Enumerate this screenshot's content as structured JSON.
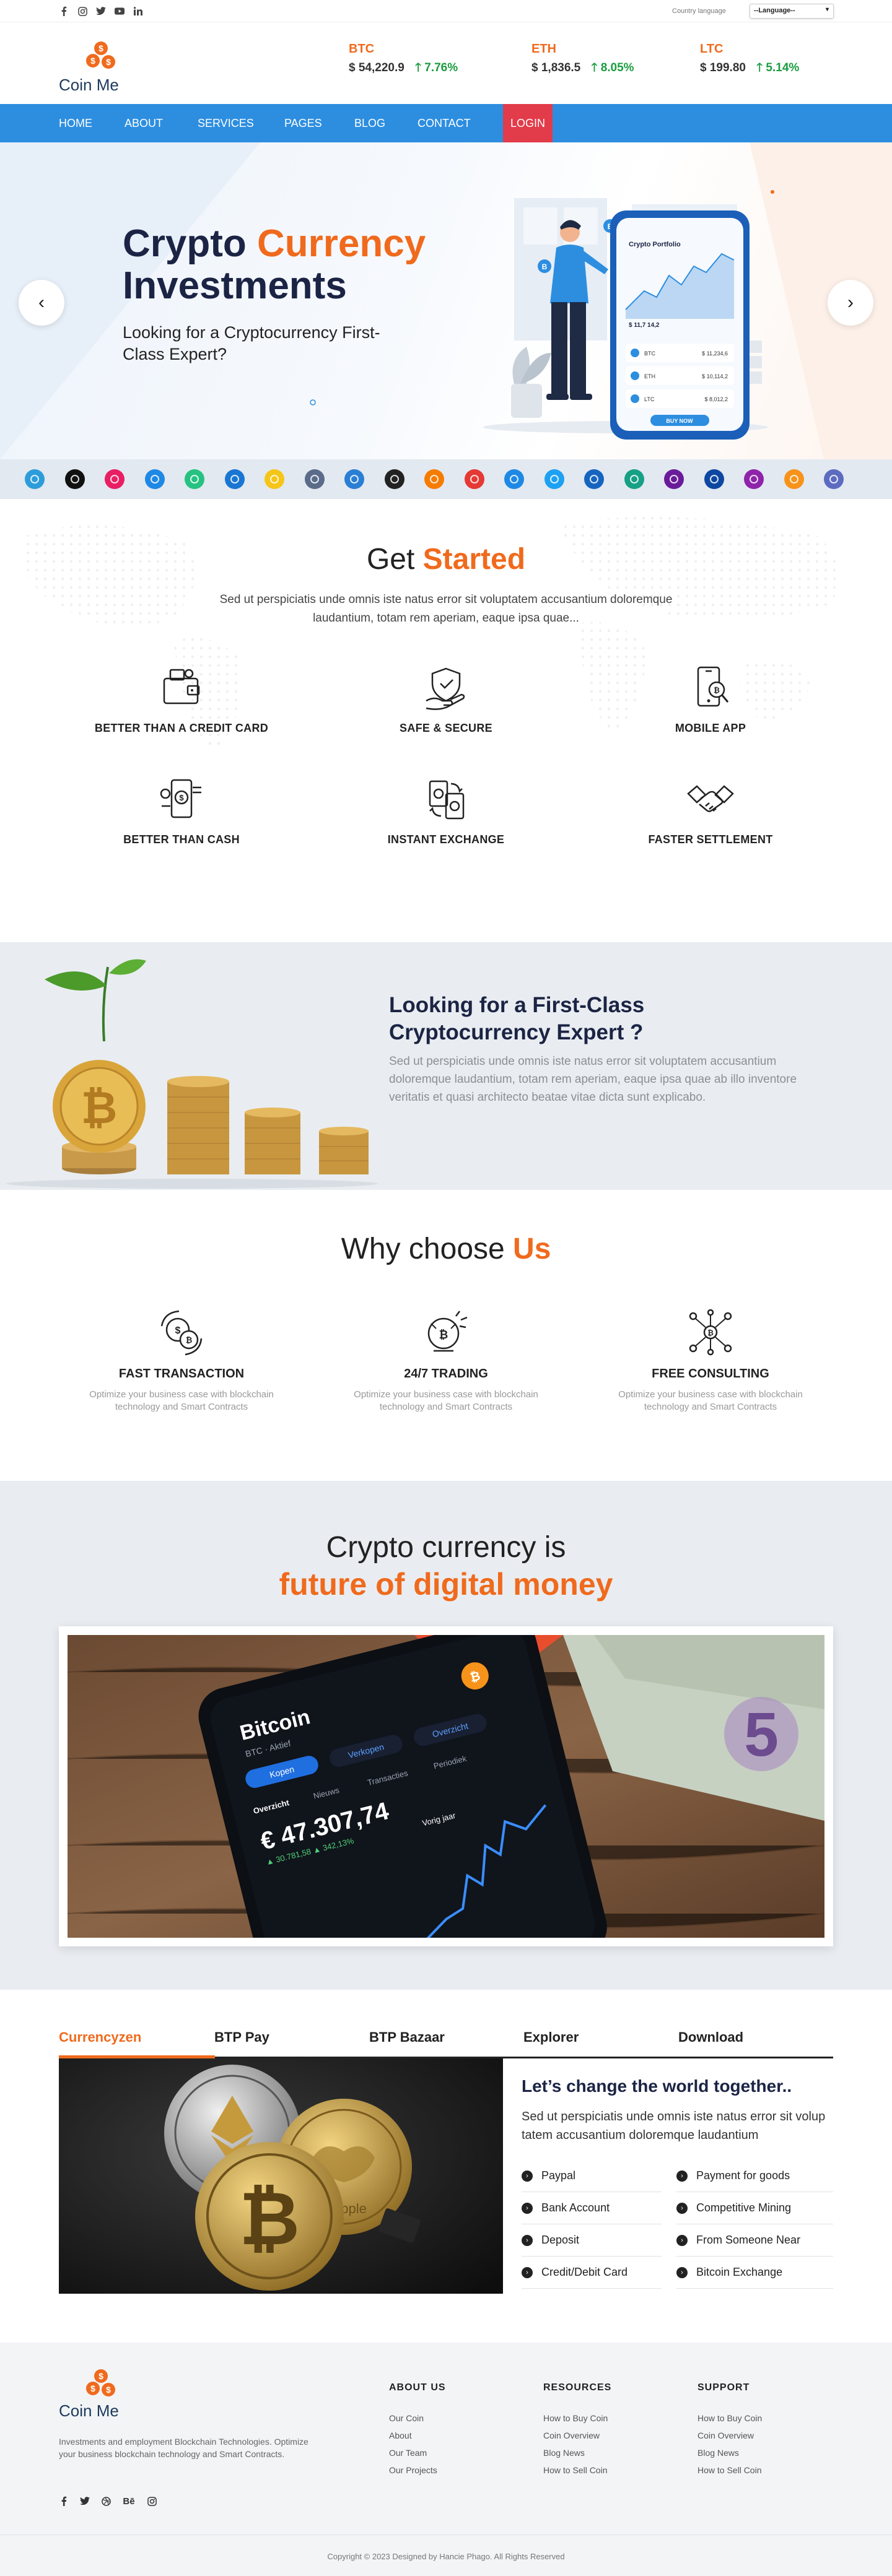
{
  "topbar": {
    "social": [
      "facebook-icon",
      "instagram-icon",
      "twitter-icon",
      "youtube-icon",
      "linkedin-icon"
    ],
    "language_label": "Country language",
    "language_value": "--Language--"
  },
  "header": {
    "logo_text": "Coin Me",
    "tickers": [
      {
        "name": "BTC",
        "price": "$ 54,220.9",
        "change": "7.76%"
      },
      {
        "name": "ETH",
        "price": "$ 1,836.5",
        "change": "8.05%"
      },
      {
        "name": "LTC",
        "price": "$ 199.80",
        "change": "5.14%"
      }
    ]
  },
  "nav": {
    "items": [
      "HOME",
      "ABOUT",
      "SERVICES",
      "PAGES",
      "BLOG",
      "CONTACT"
    ],
    "login": "LOGIN"
  },
  "hero": {
    "title_part1": "Crypto ",
    "title_part2": "Currency",
    "title_line2": "Investments",
    "subtitle": "Looking for a Cryptocurrency First-Class Expert?",
    "phone_title": "Crypto Portfolio",
    "phone_balance": "$ 11,7 14,2",
    "phone_rows": [
      {
        "coin": "BTC",
        "value": "$ 11,234,6"
      },
      {
        "coin": "ETH",
        "value": "$ 10,114,2"
      },
      {
        "coin": "LTC",
        "value": "$ 8,012,2"
      }
    ],
    "phone_button": "BUY NOW"
  },
  "coin_strip": {
    "colors": [
      "#2d9cdb",
      "#111111",
      "#e91e63",
      "#1e88e5",
      "#26c281",
      "#1976d2",
      "#f5c518",
      "#5b6b8a",
      "#2a7fd4",
      "#222222",
      "#f57c00",
      "#e53935",
      "#1e88e5",
      "#1da1f2",
      "#1565c0",
      "#16a085",
      "#6a1b9a",
      "#0d47a1",
      "#8e24aa",
      "#f7931a",
      "#5c6bc0"
    ]
  },
  "get_started": {
    "title_plain": "Get ",
    "title_accent": "Started",
    "description": "Sed ut perspiciatis unde omnis iste natus error sit voluptatem accusantium doloremque laudantium, totam rem aperiam, eaque ipsa quae...",
    "features": [
      {
        "label": "BETTER THAN A CREDIT CARD",
        "icon": "wallet-card-icon"
      },
      {
        "label": "SAFE & SECURE",
        "icon": "secure-hand-icon"
      },
      {
        "label": "MOBILE APP",
        "icon": "mobile-app-icon"
      },
      {
        "label": "BETTER THAN CASH",
        "icon": "cash-phone-icon"
      },
      {
        "label": "INSTANT EXCHANGE",
        "icon": "exchange-icon"
      },
      {
        "label": "FASTER SETTLEMENT",
        "icon": "handshake-icon"
      }
    ]
  },
  "looking": {
    "title": "Looking for a First-Class Cryptocurrency Expert ?",
    "description": "Sed ut perspiciatis unde omnis iste natus error sit voluptatem accusantium doloremque laudantium, totam rem aperiam, eaque ipsa quae ab illo inventore veritatis et quasi architecto beatae vitae dicta sunt explicabo."
  },
  "why": {
    "title_plain": "Why choose ",
    "title_accent": "Us",
    "items": [
      {
        "label": "FAST TRANSACTION",
        "desc": "Optimize your business case with blockchain technology and Smart Contracts",
        "icon": "fast-transaction-icon"
      },
      {
        "label": "24/7 TRADING",
        "desc": "Optimize your business case with blockchain technology and Smart Contracts",
        "icon": "trading-icon"
      },
      {
        "label": "FREE CONSULTING",
        "desc": "Optimize your business case with blockchain technology and Smart Contracts",
        "icon": "consulting-icon"
      }
    ]
  },
  "future": {
    "line1": "Crypto currency is",
    "line2": "future of digital money",
    "phone_label": "Bitcoin",
    "phone_sublabel": "BTC · Aktief",
    "phone_tabs": [
      "Kopen",
      "Verkopen",
      "Overzicht"
    ],
    "phone_tabs2": [
      "Overzicht",
      "Nieuws",
      "Transacties",
      "Periodiek"
    ],
    "phone_value": "€ 47.307,74",
    "phone_change": "▲ 30.781,58 ▲ 342,13%",
    "phone_period": "Vorig jaar"
  },
  "tabs": {
    "labels": [
      "Currencyzen",
      "BTP Pay",
      "BTP Bazaar",
      "Explorer",
      "Download"
    ],
    "heading": "Let’s change the world together..",
    "description": "Sed ut perspiciatis unde omnis iste natus error sit volup tatem accusantium doloremque laudantium",
    "services_left": [
      "Paypal",
      "Bank Account",
      "Deposit",
      "Credit/Debit Card"
    ],
    "services_right": [
      "Payment for goods",
      "Competitive Mining",
      "From Someone Near",
      "Bitcoin Exchange"
    ]
  },
  "footer": {
    "logo_text": "Coin Me",
    "about": "Investments and employment Blockchain Technologies. Optimize your business blockchain technology and Smart Contracts.",
    "social": [
      "facebook-icon",
      "twitter-icon",
      "dribbble-icon",
      "behance-icon",
      "instagram-icon"
    ],
    "behance_label": "Bē",
    "columns": [
      {
        "title": "ABOUT US",
        "links": [
          "Our Coin",
          "About",
          "Our Team",
          "Our Projects"
        ]
      },
      {
        "title": "RESOURCES",
        "links": [
          "How to Buy Coin",
          "Coin Overview",
          "Blog News",
          "How to Sell Coin"
        ]
      },
      {
        "title": "SUPPORT",
        "links": [
          "How to Buy Coin",
          "Coin Overview",
          "Blog News",
          "How to Sell Coin"
        ]
      }
    ],
    "copyright": "Copyright © 2023 Designed by Hancie Phago. All Rights Reserved"
  },
  "colors": {
    "accent": "#f06a1d",
    "nav": "#2d8ee0",
    "login": "#e23b4a",
    "up": "#1a9c3e",
    "navy": "#1b2444"
  }
}
